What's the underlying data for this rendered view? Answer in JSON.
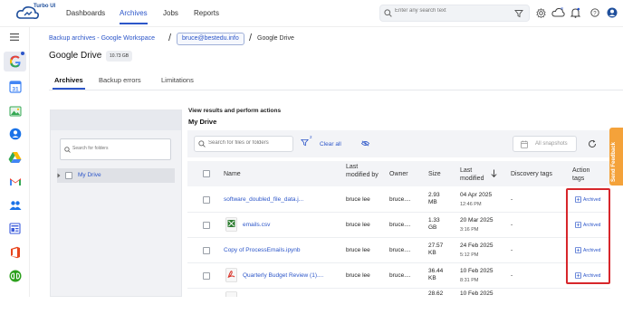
{
  "header": {
    "logo_text": "Turbo UI",
    "nav": [
      "Dashboards",
      "Archives",
      "Jobs",
      "Reports"
    ],
    "active_nav": "Archives",
    "search_placeholder": "Enter any search text"
  },
  "sidebar": {
    "icons": [
      "google-workspace-icon",
      "calendar-icon",
      "image-icon",
      "contacts-icon",
      "drive-icon",
      "gmail-icon",
      "groups-icon",
      "sites-icon",
      "office-icon",
      "quickbooks-icon"
    ]
  },
  "breadcrumb": {
    "link": "Backup archives - Google Workspace",
    "sep1": "/",
    "email": "bruce@bestedu.info",
    "sep2": "/",
    "current": "Google Drive"
  },
  "page": {
    "title": "Google Drive",
    "size": "10.73 GB"
  },
  "tabs": [
    "Archives",
    "Backup errors",
    "Limitations"
  ],
  "folder_panel": {
    "search_placeholder": "Search for folders",
    "root": "My Drive"
  },
  "results": {
    "heading": "View results and perform actions",
    "path": "My Drive",
    "search_placeholder": "Search for files or folders",
    "filter_count": "2",
    "clear_all": "Clear all",
    "snapshots": "All snapshots"
  },
  "table": {
    "columns": [
      "Name",
      "Last modified by",
      "Owner",
      "Size",
      "Last modified",
      "Discovery tags",
      "Action tags"
    ],
    "rows": [
      {
        "name": "software_doubled_file_data.j...",
        "modified_by": "bruce lee",
        "owner": "bruce....",
        "size": "2.93 MB",
        "date": "04 Apr 2025",
        "time": "12:46 PM",
        "discovery": "-",
        "action": "Archived",
        "thumb": false
      },
      {
        "name": "emails.csv",
        "modified_by": "bruce lee",
        "owner": "bruce....",
        "size": "1.33 GB",
        "date": "20 Mar 2025",
        "time": "3:16 PM",
        "discovery": "-",
        "action": "Archived",
        "thumb": "csv"
      },
      {
        "name": "Copy of ProcessEmails.ipynb",
        "modified_by": "bruce lee",
        "owner": "bruce....",
        "size": "27.57 KB",
        "date": "24 Feb 2025",
        "time": "5:12 PM",
        "discovery": "-",
        "action": "Archived",
        "thumb": false
      },
      {
        "name": "Quarterly Budget Review (1)....",
        "modified_by": "bruce lee",
        "owner": "bruce....",
        "size": "36.44 KB",
        "date": "10 Feb 2025",
        "time": "8:31 PM",
        "discovery": "-",
        "action": "Archived",
        "thumb": "pdf"
      },
      {
        "name": "",
        "modified_by": "",
        "owner": "",
        "size": "28.62",
        "date": "10 Feb 2025",
        "time": "",
        "discovery": "",
        "action": "",
        "thumb": false
      }
    ]
  },
  "feedback_label": "Send Feedback",
  "colors": {
    "accent": "#2c56c9",
    "highlight": "#d7262b",
    "feedback": "#f4a23a"
  }
}
